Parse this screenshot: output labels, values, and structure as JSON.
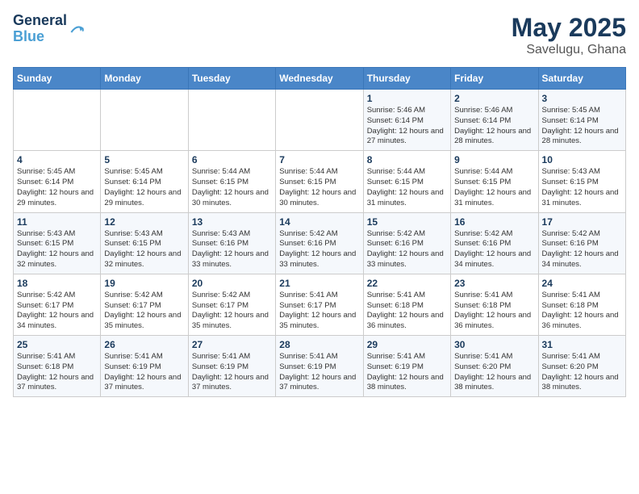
{
  "header": {
    "logo_line1": "General",
    "logo_line2": "Blue",
    "month_year": "May 2025",
    "location": "Savelugu, Ghana"
  },
  "weekdays": [
    "Sunday",
    "Monday",
    "Tuesday",
    "Wednesday",
    "Thursday",
    "Friday",
    "Saturday"
  ],
  "weeks": [
    [
      {
        "day": "",
        "info": ""
      },
      {
        "day": "",
        "info": ""
      },
      {
        "day": "",
        "info": ""
      },
      {
        "day": "",
        "info": ""
      },
      {
        "day": "1",
        "info": "Sunrise: 5:46 AM\nSunset: 6:14 PM\nDaylight: 12 hours and 27 minutes."
      },
      {
        "day": "2",
        "info": "Sunrise: 5:46 AM\nSunset: 6:14 PM\nDaylight: 12 hours and 28 minutes."
      },
      {
        "day": "3",
        "info": "Sunrise: 5:45 AM\nSunset: 6:14 PM\nDaylight: 12 hours and 28 minutes."
      }
    ],
    [
      {
        "day": "4",
        "info": "Sunrise: 5:45 AM\nSunset: 6:14 PM\nDaylight: 12 hours and 29 minutes."
      },
      {
        "day": "5",
        "info": "Sunrise: 5:45 AM\nSunset: 6:14 PM\nDaylight: 12 hours and 29 minutes."
      },
      {
        "day": "6",
        "info": "Sunrise: 5:44 AM\nSunset: 6:15 PM\nDaylight: 12 hours and 30 minutes."
      },
      {
        "day": "7",
        "info": "Sunrise: 5:44 AM\nSunset: 6:15 PM\nDaylight: 12 hours and 30 minutes."
      },
      {
        "day": "8",
        "info": "Sunrise: 5:44 AM\nSunset: 6:15 PM\nDaylight: 12 hours and 31 minutes."
      },
      {
        "day": "9",
        "info": "Sunrise: 5:44 AM\nSunset: 6:15 PM\nDaylight: 12 hours and 31 minutes."
      },
      {
        "day": "10",
        "info": "Sunrise: 5:43 AM\nSunset: 6:15 PM\nDaylight: 12 hours and 31 minutes."
      }
    ],
    [
      {
        "day": "11",
        "info": "Sunrise: 5:43 AM\nSunset: 6:15 PM\nDaylight: 12 hours and 32 minutes."
      },
      {
        "day": "12",
        "info": "Sunrise: 5:43 AM\nSunset: 6:15 PM\nDaylight: 12 hours and 32 minutes."
      },
      {
        "day": "13",
        "info": "Sunrise: 5:43 AM\nSunset: 6:16 PM\nDaylight: 12 hours and 33 minutes."
      },
      {
        "day": "14",
        "info": "Sunrise: 5:42 AM\nSunset: 6:16 PM\nDaylight: 12 hours and 33 minutes."
      },
      {
        "day": "15",
        "info": "Sunrise: 5:42 AM\nSunset: 6:16 PM\nDaylight: 12 hours and 33 minutes."
      },
      {
        "day": "16",
        "info": "Sunrise: 5:42 AM\nSunset: 6:16 PM\nDaylight: 12 hours and 34 minutes."
      },
      {
        "day": "17",
        "info": "Sunrise: 5:42 AM\nSunset: 6:16 PM\nDaylight: 12 hours and 34 minutes."
      }
    ],
    [
      {
        "day": "18",
        "info": "Sunrise: 5:42 AM\nSunset: 6:17 PM\nDaylight: 12 hours and 34 minutes."
      },
      {
        "day": "19",
        "info": "Sunrise: 5:42 AM\nSunset: 6:17 PM\nDaylight: 12 hours and 35 minutes."
      },
      {
        "day": "20",
        "info": "Sunrise: 5:42 AM\nSunset: 6:17 PM\nDaylight: 12 hours and 35 minutes."
      },
      {
        "day": "21",
        "info": "Sunrise: 5:41 AM\nSunset: 6:17 PM\nDaylight: 12 hours and 35 minutes."
      },
      {
        "day": "22",
        "info": "Sunrise: 5:41 AM\nSunset: 6:18 PM\nDaylight: 12 hours and 36 minutes."
      },
      {
        "day": "23",
        "info": "Sunrise: 5:41 AM\nSunset: 6:18 PM\nDaylight: 12 hours and 36 minutes."
      },
      {
        "day": "24",
        "info": "Sunrise: 5:41 AM\nSunset: 6:18 PM\nDaylight: 12 hours and 36 minutes."
      }
    ],
    [
      {
        "day": "25",
        "info": "Sunrise: 5:41 AM\nSunset: 6:18 PM\nDaylight: 12 hours and 37 minutes."
      },
      {
        "day": "26",
        "info": "Sunrise: 5:41 AM\nSunset: 6:19 PM\nDaylight: 12 hours and 37 minutes."
      },
      {
        "day": "27",
        "info": "Sunrise: 5:41 AM\nSunset: 6:19 PM\nDaylight: 12 hours and 37 minutes."
      },
      {
        "day": "28",
        "info": "Sunrise: 5:41 AM\nSunset: 6:19 PM\nDaylight: 12 hours and 37 minutes."
      },
      {
        "day": "29",
        "info": "Sunrise: 5:41 AM\nSunset: 6:19 PM\nDaylight: 12 hours and 38 minutes."
      },
      {
        "day": "30",
        "info": "Sunrise: 5:41 AM\nSunset: 6:20 PM\nDaylight: 12 hours and 38 minutes."
      },
      {
        "day": "31",
        "info": "Sunrise: 5:41 AM\nSunset: 6:20 PM\nDaylight: 12 hours and 38 minutes."
      }
    ]
  ]
}
